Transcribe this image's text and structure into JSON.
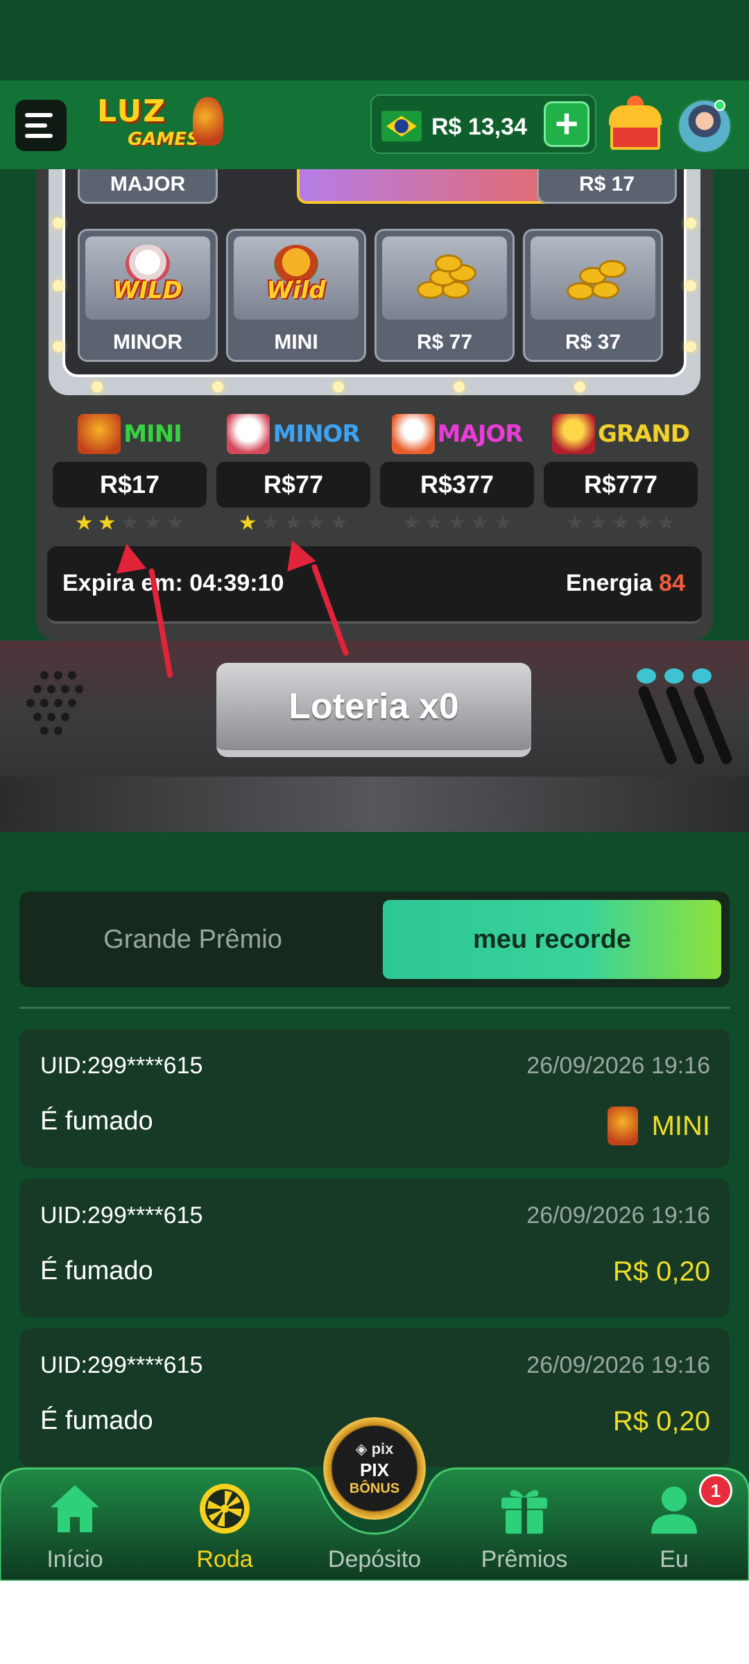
{
  "header": {
    "logo_line1": "LUZ",
    "logo_line2": "GAMES",
    "balance": "R$ 13,34",
    "add_label": "+"
  },
  "slot": {
    "top_row": [
      {
        "label": "MAJOR"
      },
      {
        "label": "R$ 17"
      }
    ],
    "bottom_row": [
      {
        "label": "MINOR",
        "art": "rabbit-wild"
      },
      {
        "label": "MINI",
        "art": "dragon-wild"
      },
      {
        "label": "R$ 77",
        "art": "coins"
      },
      {
        "label": "R$ 37",
        "art": "coins"
      }
    ]
  },
  "jackpots": [
    {
      "name": "MINI",
      "value": "R$17",
      "stars_on": 2,
      "stars_total": 5,
      "color": "#35d43f"
    },
    {
      "name": "MINOR",
      "value": "R$77",
      "stars_on": 1,
      "stars_total": 5,
      "color": "#3ea2f2"
    },
    {
      "name": "MAJOR",
      "value": "R$377",
      "stars_on": 0,
      "stars_total": 5,
      "color": "#e93cd6"
    },
    {
      "name": "GRAND",
      "value": "R$777",
      "stars_on": 0,
      "stars_total": 5,
      "color": "#f2d12a"
    }
  ],
  "timer": {
    "label": "Expira em: 04:39:10",
    "energy_label": "Energia",
    "energy_value": "84"
  },
  "lottery_button": "Loteria x0",
  "tabs": {
    "inactive": "Grande Prêmio",
    "active": "meu recorde"
  },
  "records": [
    {
      "uid": "UID:299****615",
      "time": "26/09/2026 19:16",
      "type": "É fumado",
      "prize": "MINI",
      "has_icon": true
    },
    {
      "uid": "UID:299****615",
      "time": "26/09/2026 19:16",
      "type": "É fumado",
      "prize": "R$ 0,20",
      "has_icon": false
    },
    {
      "uid": "UID:299****615",
      "time": "26/09/2026 19:16",
      "type": "É fumado",
      "prize": "R$ 0,20",
      "has_icon": false
    }
  ],
  "nav": {
    "items": [
      {
        "label": "Início",
        "icon": "home-icon"
      },
      {
        "label": "Roda",
        "icon": "wheel-icon"
      },
      {
        "label": "Depósito",
        "icon": "pix-bonus-icon"
      },
      {
        "label": "Prêmios",
        "icon": "gift-icon"
      },
      {
        "label": "Eu",
        "icon": "user-icon"
      }
    ],
    "pix_line1": "◈ pix",
    "pix_line2": "PIX",
    "pix_line3": "BÔNUS",
    "badge": "1"
  },
  "colors": {
    "background": "#0f4d2a",
    "header": "#137236",
    "accent_green": "#2ec796",
    "prize_yellow": "#f0de2a",
    "energy_red": "#f25c3c",
    "nav_active": "#f6d21e"
  }
}
